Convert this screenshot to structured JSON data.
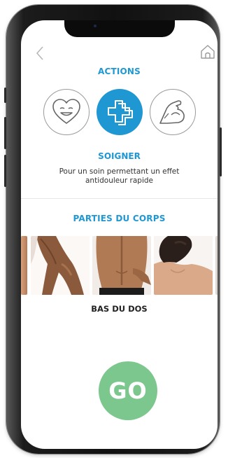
{
  "header": {
    "back_icon": "chevron-left-icon",
    "home_icon": "home-icon"
  },
  "actions": {
    "title": "ACTIONS",
    "items": [
      {
        "icon": "smiling-heart-icon",
        "selected": false
      },
      {
        "icon": "medical-cross-icon",
        "selected": true
      },
      {
        "icon": "flexed-arm-icon",
        "selected": false
      }
    ],
    "selected_name": "SOIGNER",
    "selected_description": "Pour un soin permettant un effet antidouleur rapide"
  },
  "body_parts": {
    "title": "PARTIES DU CORPS",
    "photos": [
      "arm",
      "legs",
      "lower-back",
      "shoulder",
      "next"
    ],
    "selected_label": "BAS DU DOS"
  },
  "go_button": {
    "label": "GO"
  },
  "colors": {
    "accent": "#1e97d3",
    "go": "#7cc78d"
  }
}
